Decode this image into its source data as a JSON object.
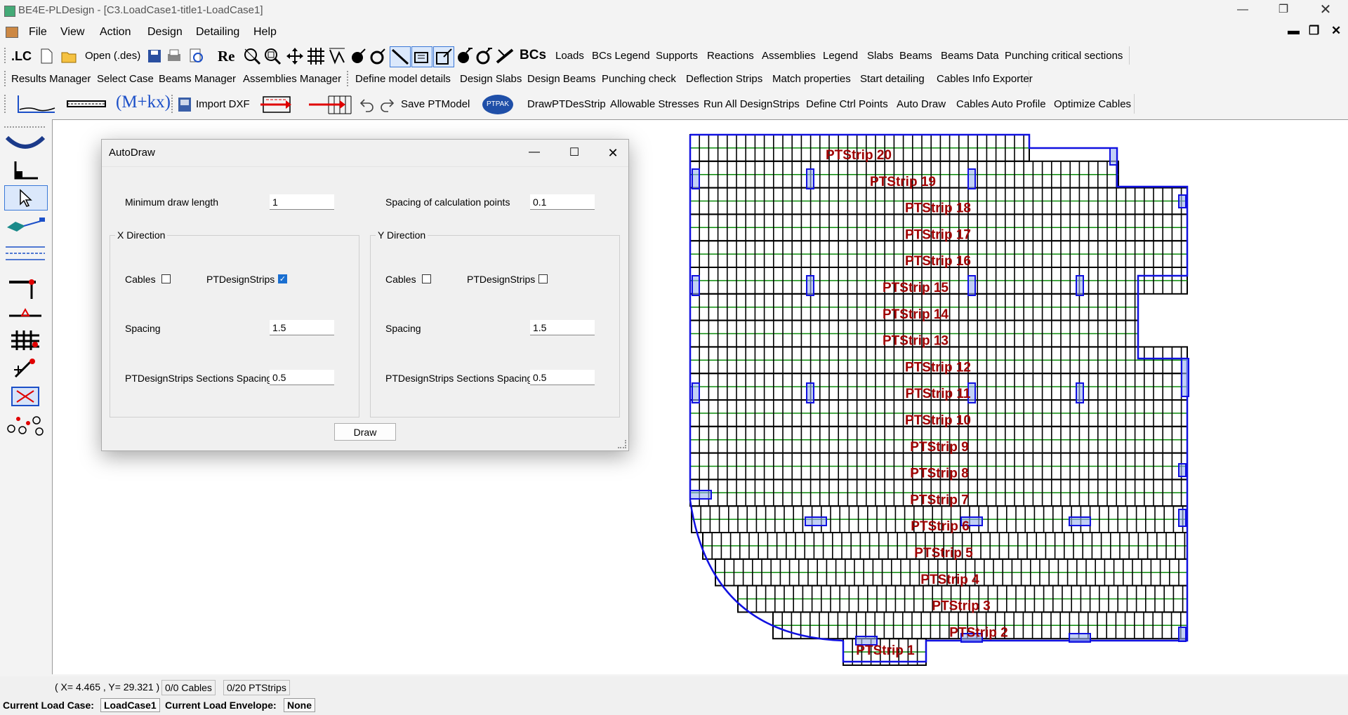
{
  "window": {
    "title": "BE4E-PLDesign - [C3.LoadCase1-title1-LoadCase1]"
  },
  "menu": {
    "items": [
      "File",
      "View",
      "Action",
      "Design",
      "Detailing",
      "Help"
    ]
  },
  "toolbar1": {
    "lc_label": ".LC",
    "open_label": "Open (.des)",
    "re_label": "Re",
    "bcs_label": "BCs",
    "buttons": [
      "Loads",
      "BCs Legend",
      "Supports",
      "Reactions",
      "Assemblies",
      "Legend",
      "Slabs",
      "Beams",
      "Beams Data",
      "Punching critical sections"
    ]
  },
  "toolbar2": {
    "buttons": [
      "Results Manager",
      "Select Case",
      "Beams Manager",
      "Assemblies Manager",
      "Define model details",
      "Design Slabs",
      "Design Beams",
      "Punching check",
      "Deflection Strips",
      "Match properties",
      "Start detailing",
      "Cables Info Exporter"
    ]
  },
  "toolbar3": {
    "formula_label": "(M+kx)",
    "import_label": "Import DXF",
    "save_label": "Save PTModel",
    "ptpak_label": "PTPAK",
    "buttons": [
      "DrawPTDesStrip",
      "Allowable Stresses",
      "Run All DesignStrips",
      "Define Ctrl Points",
      "Auto Draw",
      "Cables Auto Profile",
      "Optimize Cables"
    ]
  },
  "dialog": {
    "title": "AutoDraw",
    "min_draw_length_label": "Minimum draw length",
    "min_draw_length_value": "1",
    "spacing_calc_label": "Spacing of calculation points",
    "spacing_calc_value": "0.1",
    "x_group": {
      "title": "X Direction",
      "cables_label": "Cables",
      "cables_checked": false,
      "strips_label": "PTDesignStrips",
      "strips_checked": true,
      "spacing_label": "Spacing",
      "spacing_value": "1.5",
      "sections_label": "PTDesignStrips Sections Spacing",
      "sections_value": "0.5"
    },
    "y_group": {
      "title": "Y Direction",
      "cables_label": "Cables",
      "cables_checked": false,
      "strips_label": "PTDesignStrips",
      "strips_checked": false,
      "spacing_label": "Spacing",
      "spacing_value": "1.5",
      "sections_label": "PTDesignStrips Sections Spacing",
      "sections_value": "0.5"
    },
    "draw_label": "Draw"
  },
  "drawing": {
    "strip_labels": [
      "PTStrip 20",
      "PTStrip 19",
      "PTStrip 18",
      "PTStrip 17",
      "PTStrip 16",
      "PTStrip 15",
      "PTStrip 14",
      "PTStrip 13",
      "PTStrip 12",
      "PTStrip 11",
      "PTStrip 10",
      "PTStrip 9",
      "PTStrip 8",
      "PTStrip 7",
      "PTStrip 6",
      "PTStrip 5",
      "PTStrip 4",
      "PTStrip 3",
      "PTStrip 2",
      "PTStrip 1"
    ],
    "colors": {
      "outline": "#1010e0",
      "grid": "#000000",
      "green": "#0a8a0a",
      "label": "#a00000"
    }
  },
  "status": {
    "coords": "( X= 4.465 , Y= 29.321 )",
    "cables": "0/0 Cables",
    "strips": "0/20 PTStrips"
  },
  "loadbar": {
    "case_label": "Current Load Case:",
    "case_value": "LoadCase1",
    "envelope_label": "Current Load Envelope:",
    "envelope_value": "None"
  }
}
